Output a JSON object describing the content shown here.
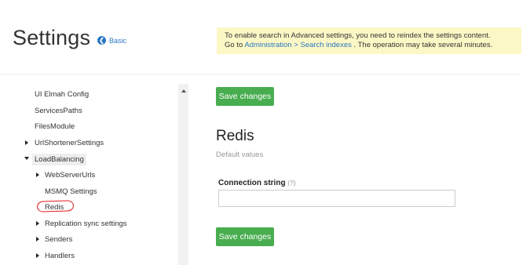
{
  "header": {
    "title": "Settings",
    "mode_toggle": {
      "icon": "circle-arrow-left-icon",
      "label": "Basic"
    }
  },
  "notice": {
    "line1": "To enable search in Advanced settings, you need to reindex the settings content.",
    "line2_prefix": "Go to ",
    "link": "Administration > Search indexes",
    "line2_suffix": " . The operation may take several minutes.",
    "background_color": "#fcf8c6"
  },
  "sidebar": {
    "items": [
      {
        "label": "UI Elmah Config"
      },
      {
        "label": "ServicesPaths"
      },
      {
        "label": "FilesModule"
      },
      {
        "label": "UrlShortenerSettings"
      },
      {
        "label": "LoadBalancing"
      },
      {
        "label": "WebServerUrls"
      },
      {
        "label": "MSMQ Settings"
      },
      {
        "label": "Redis"
      },
      {
        "label": "Replication sync settings"
      },
      {
        "label": "Senders"
      },
      {
        "label": "Handlers"
      }
    ]
  },
  "main": {
    "save_label": "Save changes",
    "section_title": "Redis",
    "section_subtitle": "Default values",
    "field_label": "Connection string",
    "field_help": "(?)",
    "field_value": "",
    "accent_color": "#48ad4f"
  }
}
